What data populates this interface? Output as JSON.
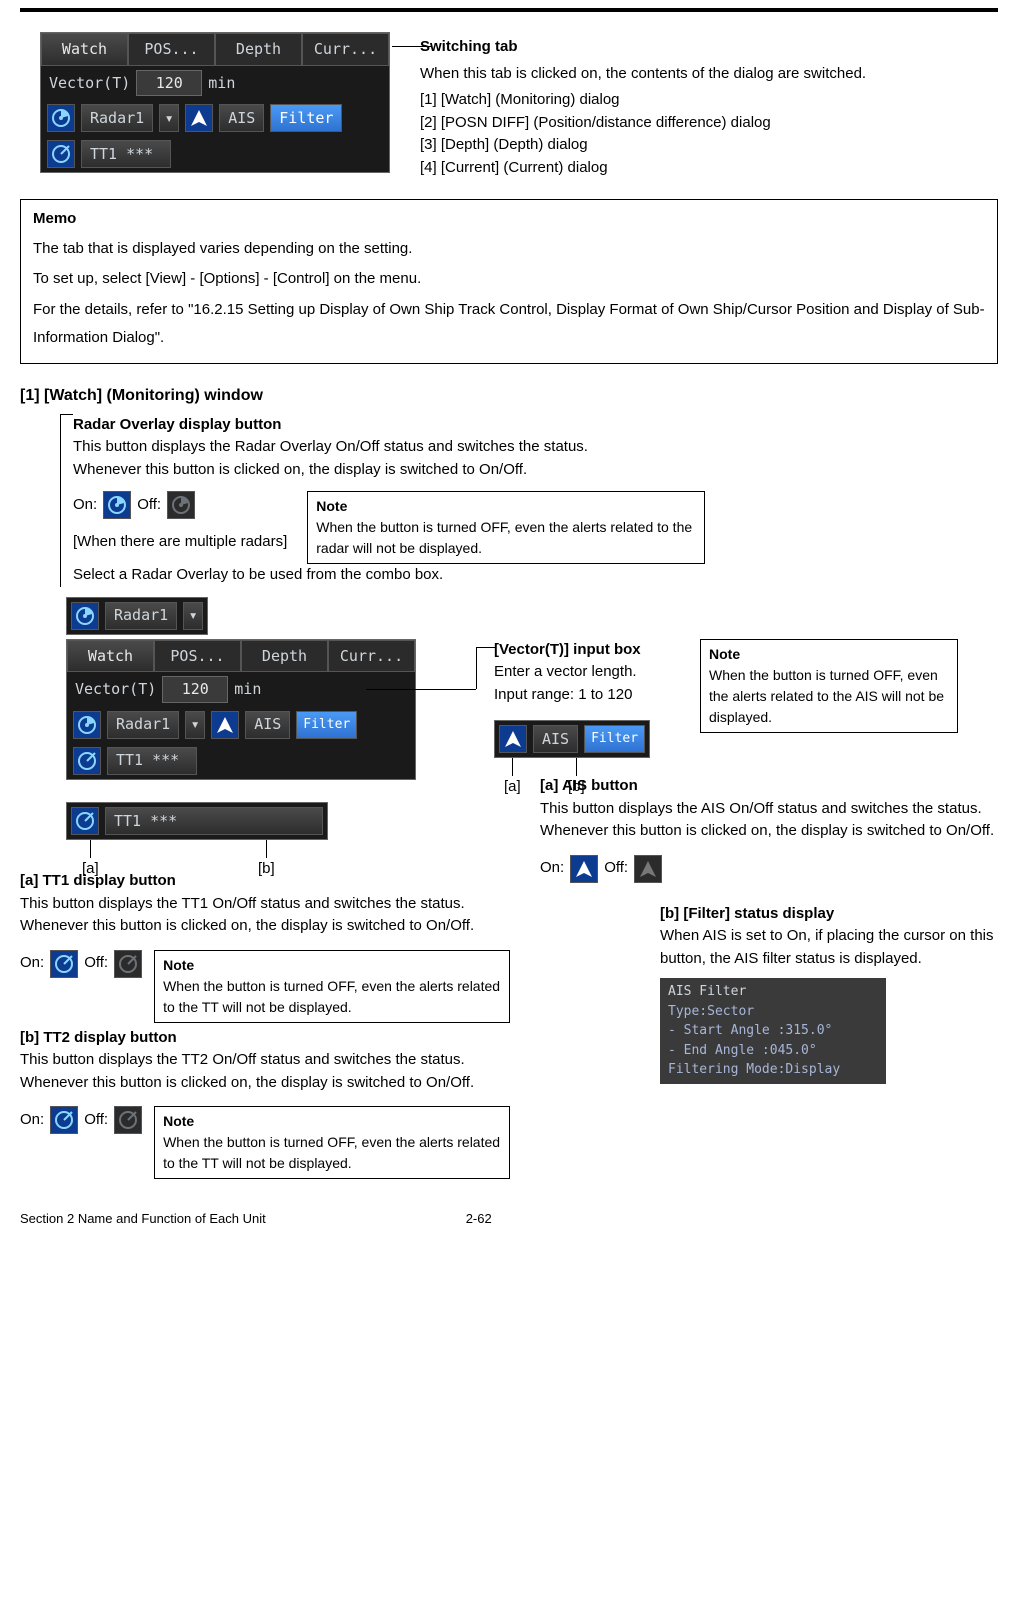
{
  "panel": {
    "tabs": [
      "Watch",
      "POS...",
      "Depth",
      "Curr..."
    ],
    "vectorLabel": "Vector(T)",
    "vectorValue": "120",
    "vectorUnit": "min",
    "radarLabel": "Radar1",
    "aisLabel": "AIS",
    "filterLabel": "Filter",
    "tt1Label": "TT1 ***"
  },
  "switching": {
    "title": "Switching tab",
    "intro": "When this tab is clicked on, the contents of the dialog are switched.",
    "items": [
      "[1]  [Watch] (Monitoring) dialog",
      "[2]  [POSN DIFF] (Position/distance difference) dialog",
      "[3]  [Depth] (Depth) dialog",
      "[4]  [Current] (Current) dialog"
    ]
  },
  "memo": {
    "title": "Memo",
    "p1": "The tab that is displayed varies depending on the setting.",
    "p2": "To set up, select [View] - [Options] - [Control] on the menu.",
    "p3": "For the details, refer to \"16.2.15 Setting up Display of Own Ship Track Control, Display Format of Own Ship/Cursor Position and Display of Sub-Information Dialog\"."
  },
  "section": {
    "title": "[1] [Watch] (Monitoring) window"
  },
  "radarOverlay": {
    "title": "Radar Overlay display button",
    "p1": "This button displays the Radar Overlay On/Off status and switches the status.",
    "p2": "Whenever this button is clicked on, the display is switched to On/Off.",
    "onLabel": "On:",
    "offLabel": "Off:",
    "multi": "[When there are multiple radars]",
    "multiDesc": "Select a Radar Overlay to be used from the combo box.",
    "noteTitle": "Note",
    "noteBody": "When the button is turned OFF, even the alerts related to the radar will not be displayed."
  },
  "vectorBox": {
    "title": "[Vector(T)] input box",
    "p1": "Enter a vector length.",
    "p2": "Input range: 1 to 120"
  },
  "aisNote": {
    "title": "Note",
    "body": "When the button is turned OFF, even the alerts related to the AIS will not be displayed."
  },
  "abLabels": {
    "a": "[a]",
    "b": "[b]"
  },
  "tt1": {
    "title": "[a] TT1 display button",
    "p1": "This button displays the TT1 On/Off status and switches the status.",
    "p2": "Whenever this button is clicked on, the display is switched to On/Off.",
    "onLabel": "On:",
    "offLabel": "Off:"
  },
  "ttNote": {
    "title": "Note",
    "body": "When the button is turned OFF, even the alerts related to the TT will not be displayed."
  },
  "tt2": {
    "title": "[b] TT2 display button",
    "p1": "This button displays the TT2 On/Off status and switches the status.",
    "p2": "Whenever this button is clicked on, the display is switched to On/Off.",
    "onLabel": "On:",
    "offLabel": "Off:"
  },
  "aisBtn": {
    "title": "[a] AIS button",
    "p1": "This button displays the AIS On/Off status and switches the status.",
    "p2": "Whenever this button is clicked on, the display is switched to On/Off.",
    "onLabel": "On:",
    "offLabel": "Off:"
  },
  "filterStatus": {
    "title": "[b] [Filter] status display",
    "body": "When AIS is set to On, if placing the cursor on this button, the AIS filter status is displayed."
  },
  "aisTooltip": {
    "l1": "AIS Filter",
    "l2": "Type:Sector",
    "l3": "  - Start Angle :315.0°",
    "l4": "  - End Angle :045.0°",
    "l5": "Filtering Mode:Display"
  },
  "footer": {
    "left": "Section 2    Name and Function of Each Unit",
    "page": "2-62"
  }
}
